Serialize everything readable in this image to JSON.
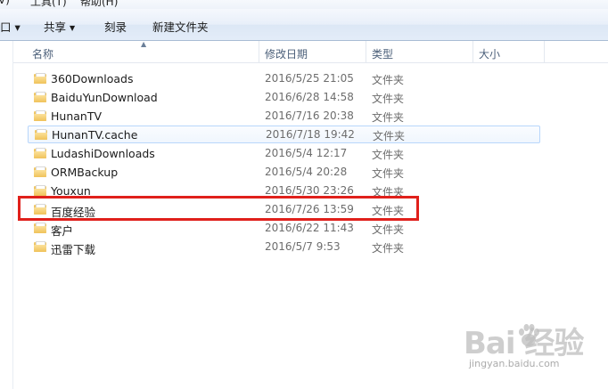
{
  "menubar": {
    "items": [
      {
        "label": "V)"
      },
      {
        "label": "工具(T)"
      },
      {
        "label": "帮助(H)"
      }
    ]
  },
  "toolbar": {
    "left_fragment": "口 ▾",
    "share_label": "共享",
    "burn_label": "刻录",
    "new_folder_label": "新建文件夹"
  },
  "columns": {
    "name": "名称",
    "modified": "修改日期",
    "type": "类型",
    "size": "大小"
  },
  "files": [
    {
      "name": "360Downloads",
      "modified": "2016/5/25 21:05",
      "type": "文件夹"
    },
    {
      "name": "BaiduYunDownload",
      "modified": "2016/6/28 14:58",
      "type": "文件夹"
    },
    {
      "name": "HunanTV",
      "modified": "2016/7/16 20:38",
      "type": "文件夹"
    },
    {
      "name": "HunanTV.cache",
      "modified": "2016/7/18 19:42",
      "type": "文件夹"
    },
    {
      "name": "LudashiDownloads",
      "modified": "2016/5/4 12:17",
      "type": "文件夹"
    },
    {
      "name": "ORMBackup",
      "modified": "2016/5/4 20:28",
      "type": "文件夹"
    },
    {
      "name": "Youxun",
      "modified": "2016/5/30 23:26",
      "type": "文件夹"
    },
    {
      "name": "百度经验",
      "modified": "2016/7/26 13:59",
      "type": "文件夹"
    },
    {
      "name": "客户",
      "modified": "2016/6/22 11:43",
      "type": "文件夹"
    },
    {
      "name": "迅雷下载",
      "modified": "2016/5/7 9:53",
      "type": "文件夹"
    }
  ],
  "watermark": {
    "main": "Bai  经验",
    "sub": "jingyan.baidu.com"
  },
  "colors": {
    "highlight": "#e0201b",
    "selection_border": "#b8d6fb",
    "folder": "#f0c25a"
  }
}
